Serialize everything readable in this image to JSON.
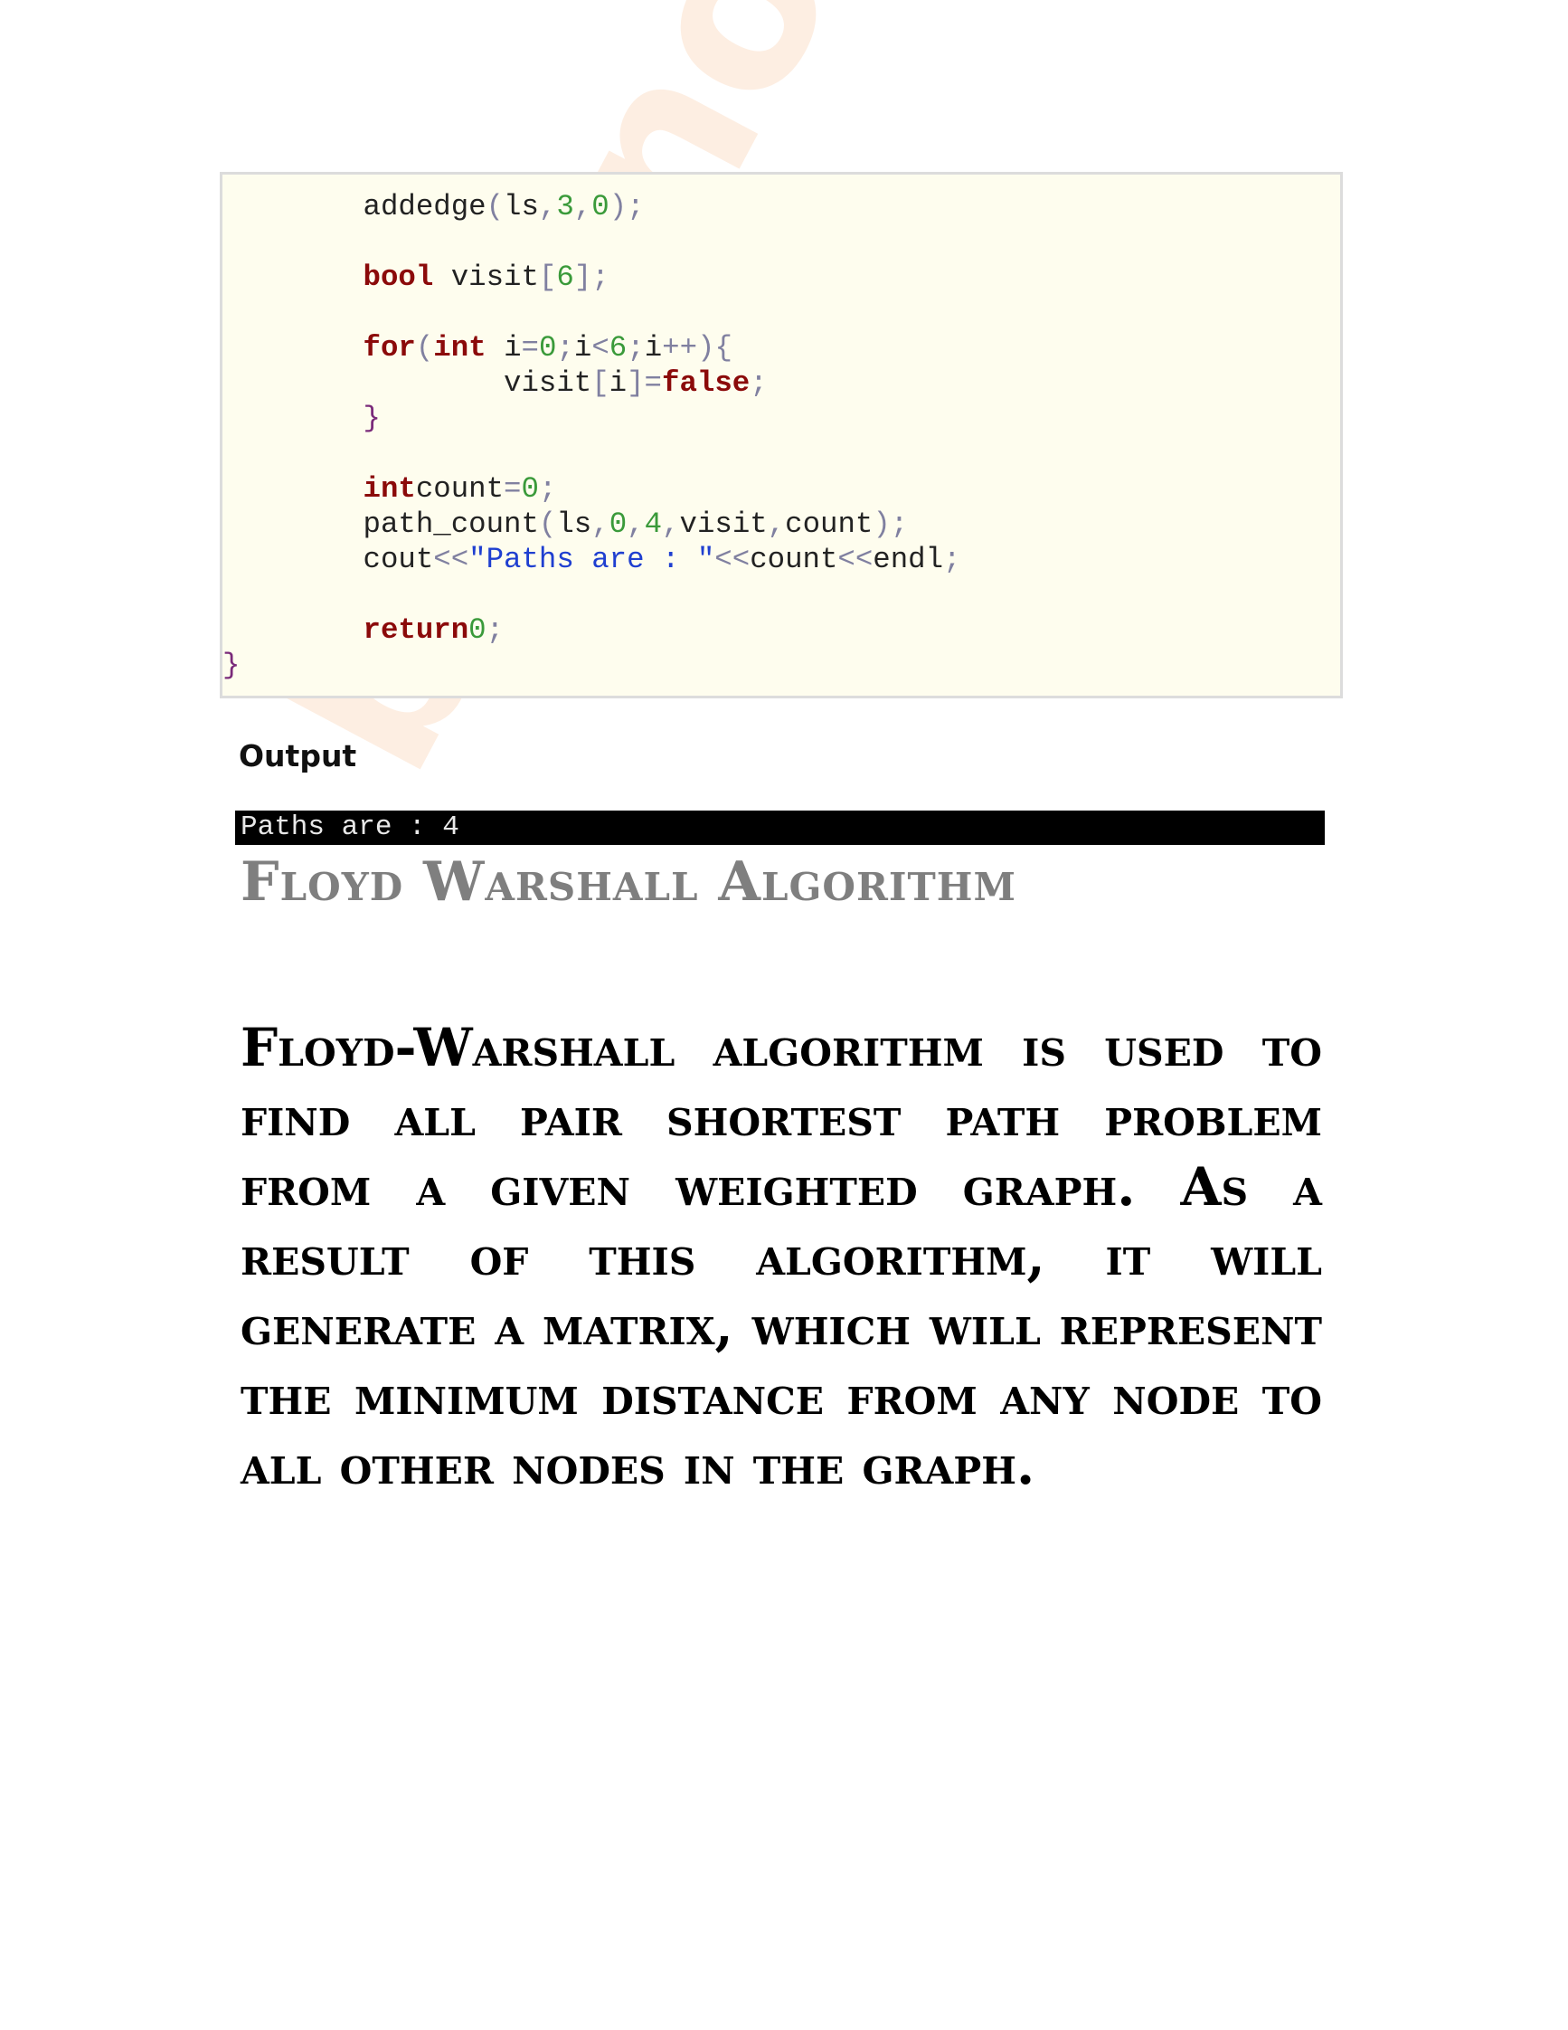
{
  "watermark": "bhrunote",
  "code": {
    "lines": [
      [
        {
          "t": "        addedge"
        },
        {
          "t": "(",
          "c": "op"
        },
        {
          "t": "ls"
        },
        {
          "t": ",",
          "c": "op"
        },
        {
          "t": "3",
          "c": "num"
        },
        {
          "t": ",",
          "c": "op"
        },
        {
          "t": "0",
          "c": "num"
        },
        {
          "t": ");",
          "c": "op"
        }
      ],
      [],
      [
        {
          "t": "        "
        },
        {
          "t": "bool",
          "c": "kw"
        },
        {
          "t": " visit"
        },
        {
          "t": "[",
          "c": "op"
        },
        {
          "t": "6",
          "c": "num"
        },
        {
          "t": "];",
          "c": "op"
        }
      ],
      [],
      [
        {
          "t": "        "
        },
        {
          "t": "for",
          "c": "kw"
        },
        {
          "t": "(",
          "c": "op"
        },
        {
          "t": "int",
          "c": "kw"
        },
        {
          "t": " i"
        },
        {
          "t": "=",
          "c": "op"
        },
        {
          "t": "0",
          "c": "num"
        },
        {
          "t": ";",
          "c": "op"
        },
        {
          "t": "i"
        },
        {
          "t": "<",
          "c": "op"
        },
        {
          "t": "6",
          "c": "num"
        },
        {
          "t": ";",
          "c": "op"
        },
        {
          "t": "i"
        },
        {
          "t": "++){",
          "c": "op"
        }
      ],
      [
        {
          "t": "                visit"
        },
        {
          "t": "[",
          "c": "op"
        },
        {
          "t": "i"
        },
        {
          "t": "]=",
          "c": "op"
        },
        {
          "t": "false",
          "c": "kw"
        },
        {
          "t": ";",
          "c": "op"
        }
      ],
      [
        {
          "t": "        "
        },
        {
          "t": "}",
          "c": "br"
        }
      ],
      [],
      [
        {
          "t": "        "
        },
        {
          "t": "int",
          "c": "kw"
        },
        {
          "t": "count"
        },
        {
          "t": "=",
          "c": "op"
        },
        {
          "t": "0",
          "c": "num"
        },
        {
          "t": ";",
          "c": "op"
        }
      ],
      [
        {
          "t": "        path_count"
        },
        {
          "t": "(",
          "c": "op"
        },
        {
          "t": "ls"
        },
        {
          "t": ",",
          "c": "op"
        },
        {
          "t": "0",
          "c": "num"
        },
        {
          "t": ",",
          "c": "op"
        },
        {
          "t": "4",
          "c": "num"
        },
        {
          "t": ",",
          "c": "op"
        },
        {
          "t": "visit"
        },
        {
          "t": ",",
          "c": "op"
        },
        {
          "t": "count"
        },
        {
          "t": ");",
          "c": "op"
        }
      ],
      [
        {
          "t": "        cout"
        },
        {
          "t": "<<",
          "c": "op"
        },
        {
          "t": "\"Paths are : \"",
          "c": "str"
        },
        {
          "t": "<<",
          "c": "op"
        },
        {
          "t": "count"
        },
        {
          "t": "<<",
          "c": "op"
        },
        {
          "t": "endl"
        },
        {
          "t": ";",
          "c": "op"
        }
      ],
      [],
      [
        {
          "t": "        "
        },
        {
          "t": "return",
          "c": "kw"
        },
        {
          "t": "0",
          "c": "num"
        },
        {
          "t": ";",
          "c": "op"
        }
      ],
      [
        {
          "t": "}",
          "c": "br"
        }
      ]
    ]
  },
  "output_label": "Output",
  "console_text": "Paths are : 4",
  "section_title": "Floyd Warshall Algorithm",
  "paragraph": "Floyd-Warshall algorithm is used to find all pair shortest path problem from a given weighted graph. As a result of this algorithm, it will generate a matrix, which will represent the minimum distance from any node to all other nodes in the graph."
}
